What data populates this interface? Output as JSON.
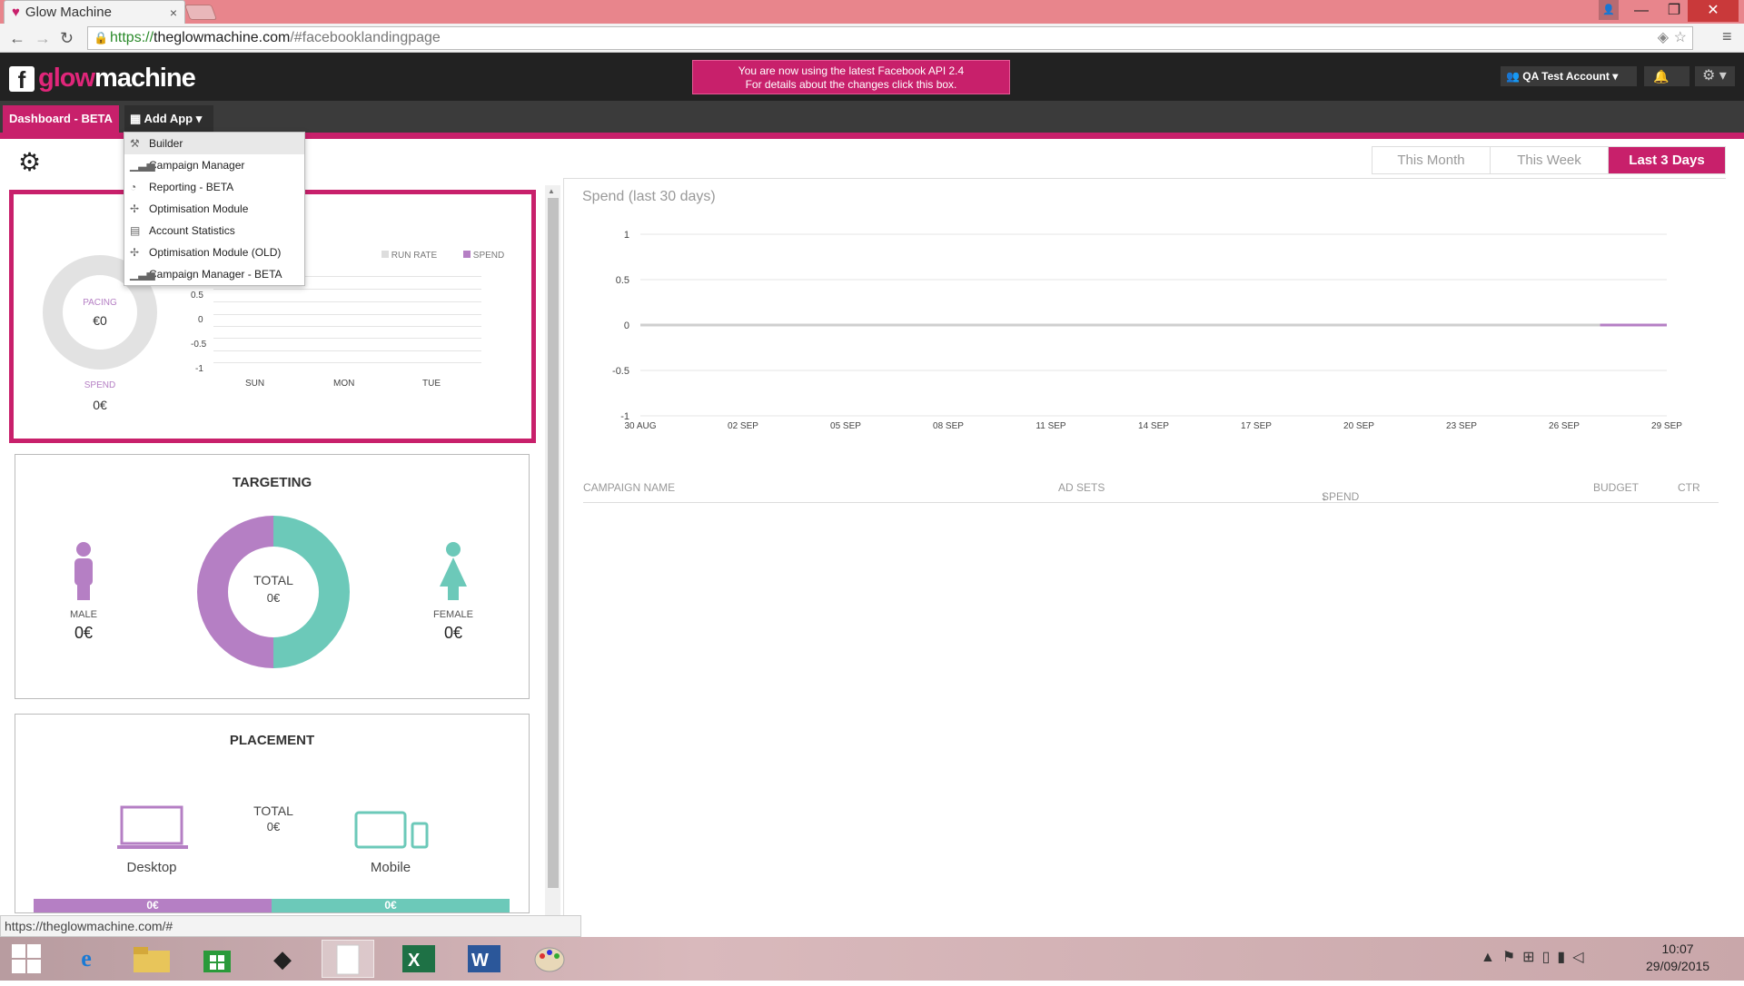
{
  "browser": {
    "tab_title": "Glow Machine",
    "tab_close": "×",
    "url_scheme": "https://",
    "url_host": "theglowmachine.com",
    "url_path": "/#facebooklandingpage",
    "status_url": "https://theglowmachine.com/#"
  },
  "header": {
    "logo_glow": "glow",
    "logo_machine": "machine",
    "notice_line1": "You are now using the latest Facebook API 2.4",
    "notice_line2": "For details about the changes click this box.",
    "account": "QA Test Account"
  },
  "nav": {
    "dashboard": "Dashboard - BETA",
    "add_app": "Add App",
    "menu": [
      {
        "label": "Builder",
        "icon": "wrench-icon"
      },
      {
        "label": "Campaign Manager",
        "icon": "bar-chart-icon"
      },
      {
        "label": "Reporting - BETA",
        "icon": "pie-chart-icon"
      },
      {
        "label": "Optimisation Module",
        "icon": "optimise-icon"
      },
      {
        "label": "Account Statistics",
        "icon": "table-icon"
      },
      {
        "label": "Optimisation Module (OLD)",
        "icon": "optimise-icon"
      },
      {
        "label": "Campaign Manager - BETA",
        "icon": "bar-chart-icon"
      }
    ]
  },
  "periods": {
    "month": "This Month",
    "week": "This Week",
    "days": "Last 3 Days",
    "active": "Last 3 Days"
  },
  "pacing": {
    "label": "PACING",
    "value": "€0",
    "spend_label": "SPEND",
    "spend_value": "0€",
    "legend_run": "RUN RATE",
    "legend_spend": "SPEND",
    "y_ticks": [
      "0.5",
      "0",
      "-0.5",
      "-1"
    ],
    "x_ticks": [
      "SUN",
      "MON",
      "TUE"
    ]
  },
  "targeting": {
    "title": "TARGETING",
    "male_label": "MALE",
    "male_value": "0€",
    "female_label": "FEMALE",
    "female_value": "0€",
    "total_label": "TOTAL",
    "total_value": "0€"
  },
  "placement": {
    "title": "PLACEMENT",
    "total_label": "TOTAL",
    "total_value": "0€",
    "desktop": "Desktop",
    "mobile": "Mobile",
    "bar_left": "0€",
    "bar_right": "0€"
  },
  "chart_data": {
    "type": "line",
    "title": "Spend (last 30 days)",
    "x": [
      "30 AUG",
      "02 SEP",
      "05 SEP",
      "08 SEP",
      "11 SEP",
      "14 SEP",
      "17 SEP",
      "20 SEP",
      "23 SEP",
      "26 SEP",
      "29 SEP"
    ],
    "y_ticks": [
      "1",
      "0.5",
      "0",
      "-0.5",
      "-1"
    ],
    "ylim": [
      -1,
      1
    ],
    "series": [
      {
        "values": [
          0,
          0,
          0,
          0,
          0,
          0,
          0,
          0,
          0,
          0,
          0
        ]
      }
    ],
    "grid": true
  },
  "table": {
    "columns": [
      "CAMPAIGN NAME",
      "AD SETS",
      "SPEND",
      "BUDGET",
      "CTR"
    ],
    "rows": []
  },
  "taskbar": {
    "time": "10:07",
    "date": "29/09/2015"
  },
  "colors": {
    "brand": "#c8206b",
    "male": "#b57fc4",
    "female": "#6cc9b9"
  }
}
